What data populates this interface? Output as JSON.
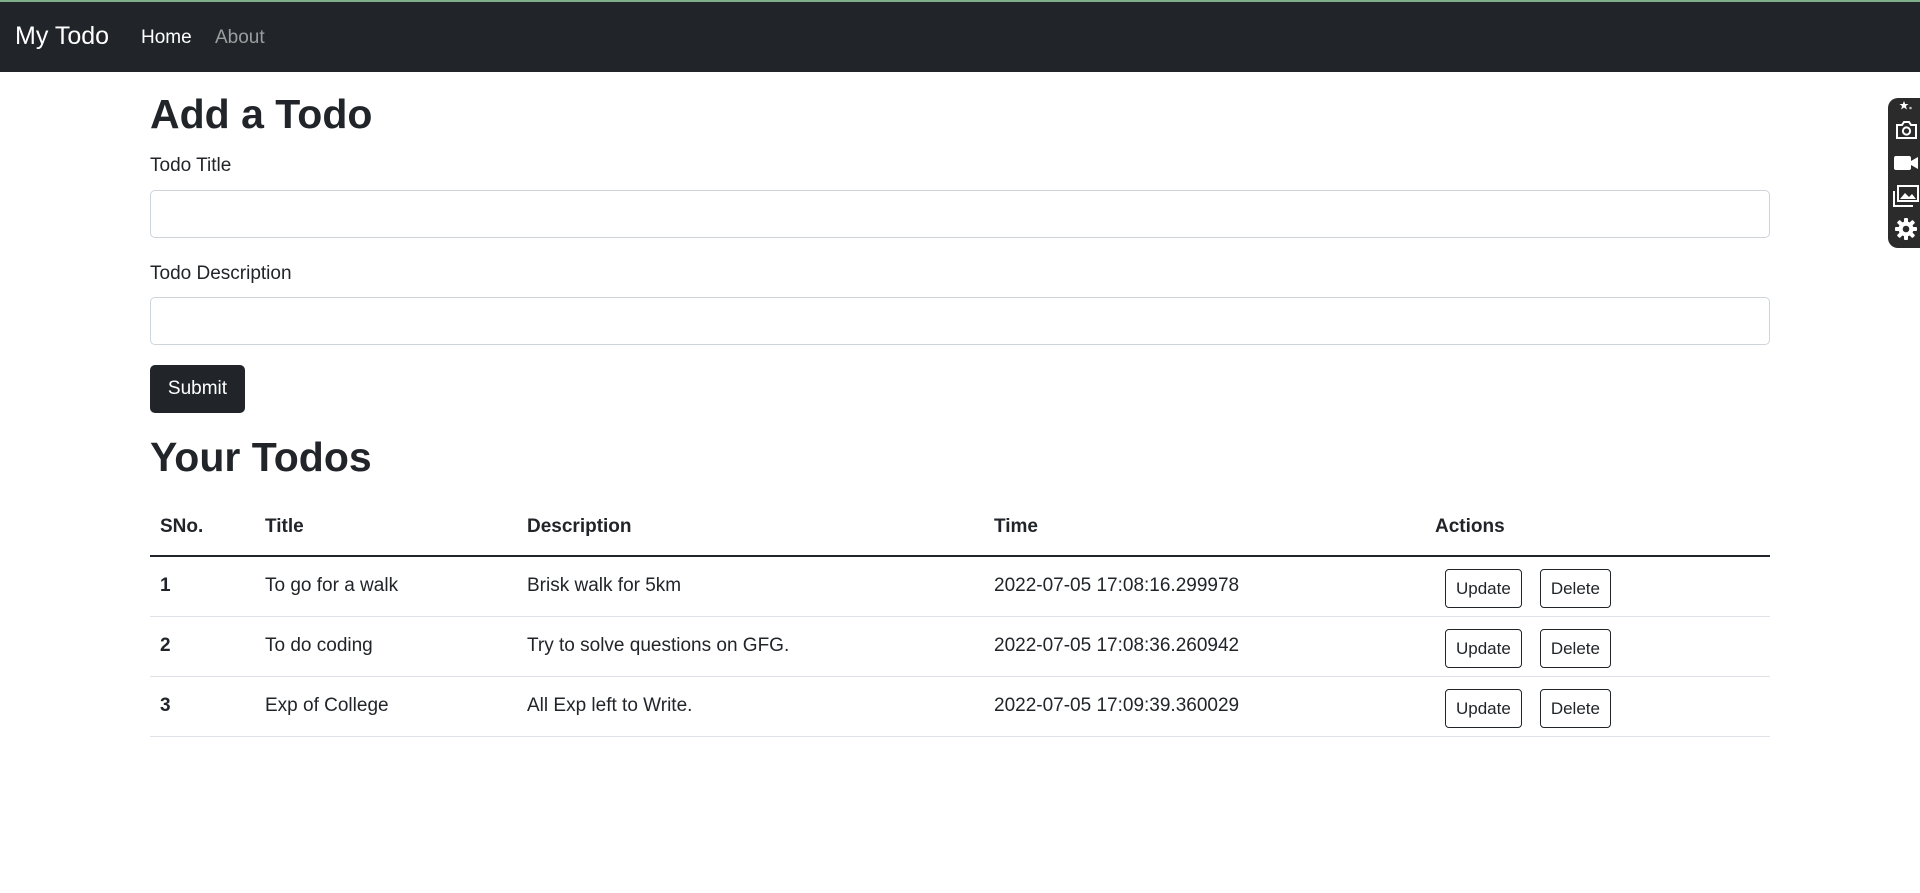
{
  "navbar": {
    "brand": "My Todo",
    "links": [
      "Home",
      "About"
    ]
  },
  "form": {
    "heading": "Add a Todo",
    "title_label": "Todo Title",
    "title_value": "",
    "description_label": "Todo Description",
    "description_value": "",
    "submit_label": "Submit"
  },
  "todos": {
    "heading": "Your Todos",
    "columns": [
      "SNo.",
      "Title",
      "Description",
      "Time",
      "Actions"
    ],
    "rows": [
      {
        "sno": "1",
        "title": "To go for a walk",
        "description": "Brisk walk for 5km",
        "time": "2022-07-05 17:08:16.299978"
      },
      {
        "sno": "2",
        "title": "To do coding",
        "description": "Try to solve questions on GFG.",
        "time": "2022-07-05 17:08:36.260942"
      },
      {
        "sno": "3",
        "title": "Exp of College",
        "description": "All Exp left to Write.",
        "time": "2022-07-05 17:09:39.360029"
      }
    ],
    "update_label": "Update",
    "delete_label": "Delete"
  },
  "side_toolbar": {
    "icons": [
      "pin-icon",
      "camera-icon",
      "video-icon",
      "gallery-icon",
      "gear-icon"
    ]
  },
  "colors": {
    "navbar_bg": "#212529",
    "button_dark": "#212529"
  }
}
